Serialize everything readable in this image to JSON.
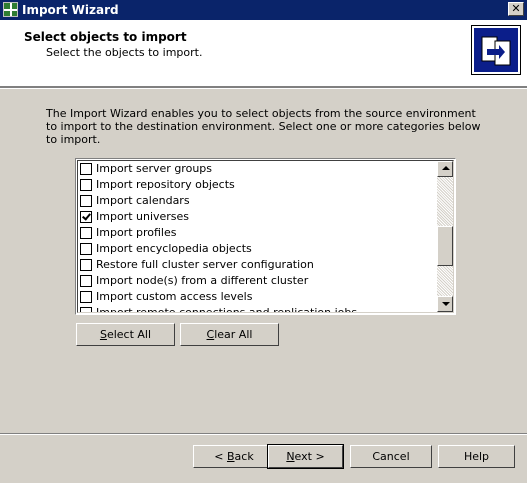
{
  "window": {
    "title": "Import Wizard"
  },
  "header": {
    "heading": "Select objects to import",
    "subheading": "Select the objects to import."
  },
  "intro": "The Import Wizard enables you to select objects from the source environment to import to the destination environment. Select one or more categories below to import.",
  "list": {
    "items": [
      {
        "label": "Import server groups",
        "checked": false
      },
      {
        "label": "Import repository objects",
        "checked": false
      },
      {
        "label": "Import calendars",
        "checked": false
      },
      {
        "label": "Import universes",
        "checked": true
      },
      {
        "label": "Import profiles",
        "checked": false
      },
      {
        "label": "Import encyclopedia objects",
        "checked": false
      },
      {
        "label": "Restore full cluster server configuration",
        "checked": false
      },
      {
        "label": "Import node(s) from a different cluster",
        "checked": false
      },
      {
        "label": "Import custom access levels",
        "checked": false
      },
      {
        "label": "Import remote connections and replication jobs",
        "checked": false
      }
    ],
    "scroll_position": 0.62
  },
  "buttons": {
    "select_all": {
      "mnemonic": "S",
      "rest": "elect All"
    },
    "clear_all": {
      "mnemonic": "C",
      "rest": "lear All"
    },
    "back": {
      "prefix": "< ",
      "mnemonic": "B",
      "rest": "ack"
    },
    "next": {
      "mnemonic": "N",
      "rest": "ext >"
    },
    "cancel": "Cancel",
    "help": "Help"
  },
  "icons": {
    "app": "app-icon",
    "close": "close-icon",
    "wizard": "import-wizard-icon"
  }
}
